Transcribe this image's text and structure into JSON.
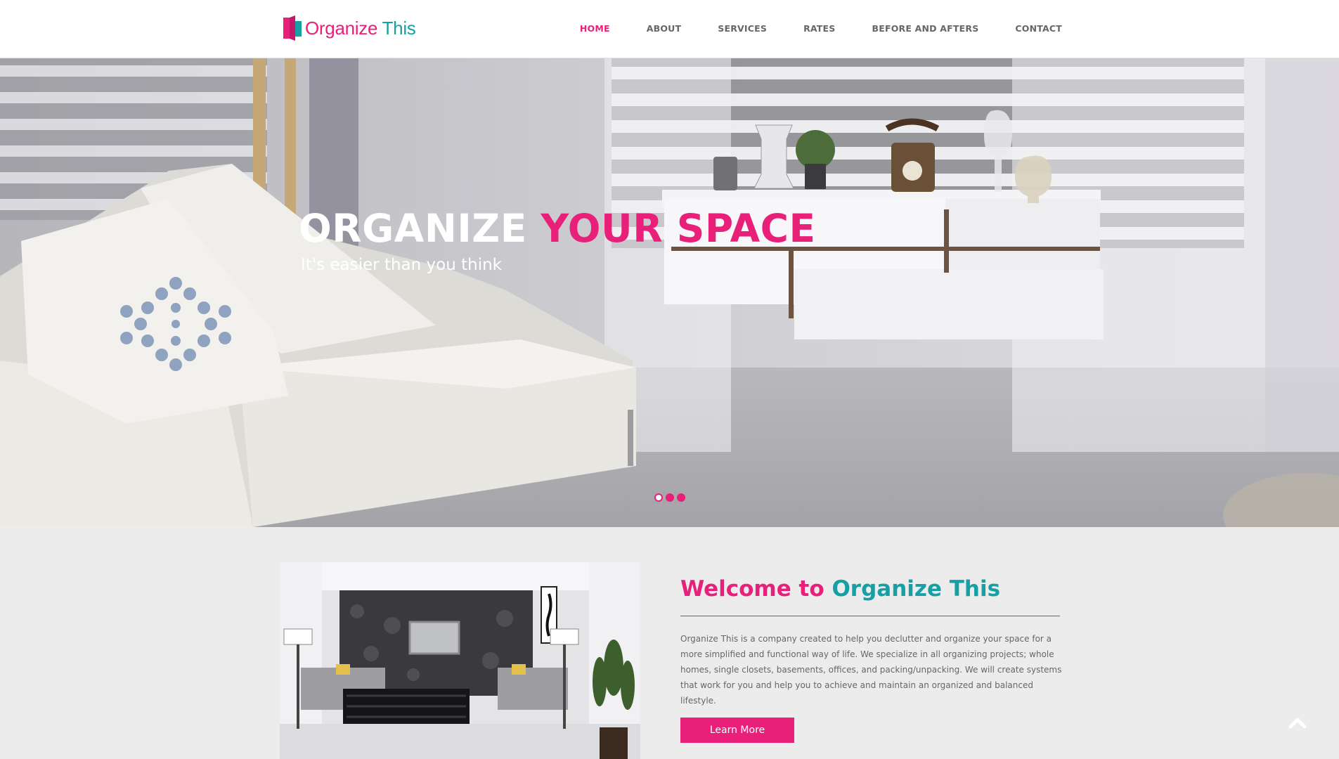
{
  "brand": {
    "name_part1": "Organize",
    "name_part2": "This"
  },
  "nav": {
    "items": [
      {
        "label": "HOME"
      },
      {
        "label": "ABOUT"
      },
      {
        "label": "SERVICES"
      },
      {
        "label": "RATES"
      },
      {
        "label": "BEFORE AND AFTERS"
      },
      {
        "label": "CONTACT"
      }
    ],
    "active": "HOME"
  },
  "hero": {
    "title_part1": "ORGANIZE",
    "title_part2": "YOUR SPACE",
    "subtitle": "It's easier than you think",
    "slides_count": 3,
    "active_slide": 1
  },
  "welcome": {
    "title_part1": "Welcome to",
    "title_part2": "Organize This",
    "body": "Organize This is a company created to help you declutter and organize your space for a more simplified and functional way of life. We specialize in all organizing projects; whole homes, single closets, basements, offices, and packing/unpacking. We will create systems that work for you and help you to achieve and maintain an organized and balanced lifestyle.",
    "button_label": "Learn More"
  },
  "icons": {
    "logo": "book-logo-icon",
    "scroll_top": "chevron-up-icon"
  },
  "colors": {
    "accent_pink": "#e8207a",
    "accent_teal": "#16a0a6",
    "nav_text": "#666666",
    "section_bg": "#ececec"
  }
}
